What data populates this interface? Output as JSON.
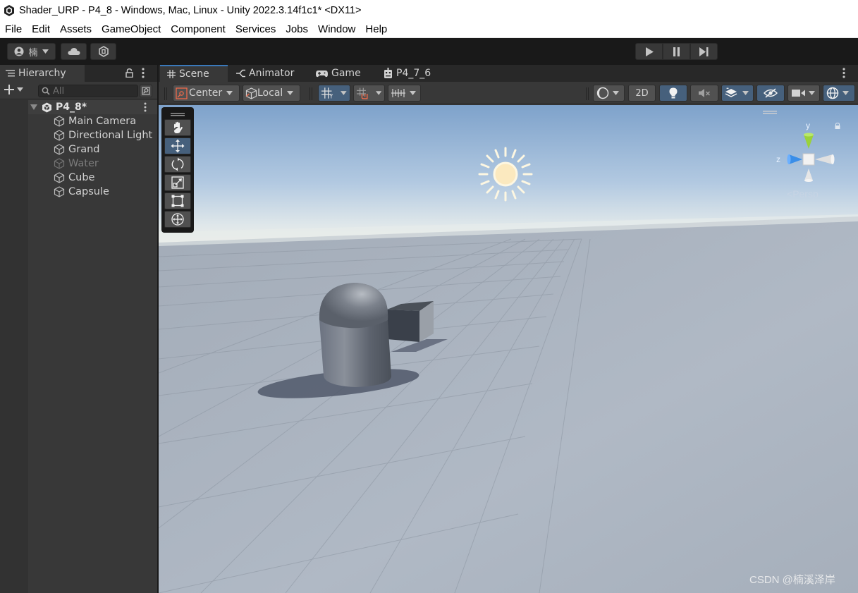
{
  "window": {
    "title": "Shader_URP - P4_8 - Windows, Mac, Linux - Unity 2022.3.14f1c1* <DX11>"
  },
  "menu": [
    "File",
    "Edit",
    "Assets",
    "GameObject",
    "Component",
    "Services",
    "Jobs",
    "Window",
    "Help"
  ],
  "main_toolbar": {
    "account_label": "楠",
    "icons": [
      "account-icon",
      "cloud-icon",
      "collab-icon",
      "play-icon",
      "pause-icon",
      "step-icon"
    ]
  },
  "hierarchy": {
    "tab_label": "Hierarchy",
    "search_placeholder": "All",
    "scene_name": "P4_8*",
    "objects": [
      {
        "name": "Main Camera",
        "active": true
      },
      {
        "name": "Directional Light",
        "active": true
      },
      {
        "name": "Grand",
        "active": true
      },
      {
        "name": "Water",
        "active": false
      },
      {
        "name": "Cube",
        "active": true
      },
      {
        "name": "Capsule",
        "active": true
      }
    ]
  },
  "scene_tabs": [
    {
      "label": "Scene",
      "icon": "grid-icon",
      "active": true
    },
    {
      "label": "Animator",
      "icon": "animator-icon",
      "active": false
    },
    {
      "label": "Game",
      "icon": "gamepad-icon",
      "active": false
    },
    {
      "label": "P4_7_6",
      "icon": "robot-icon",
      "active": false
    }
  ],
  "scene_toolbar": {
    "pivot_mode": "Center",
    "pivot_rotation": "Local",
    "toggle_2d": "2D"
  },
  "scene_view": {
    "projection_label": "Persp",
    "gizmo_axes": {
      "y": "y",
      "z": "z"
    },
    "watermark": "CSDN @楠溪泽岸"
  },
  "colors": {
    "accent": "#3a79bb",
    "active_tool": "#46607c",
    "sky_top": "#7fa3cb",
    "ground": "#a9b3bf"
  }
}
